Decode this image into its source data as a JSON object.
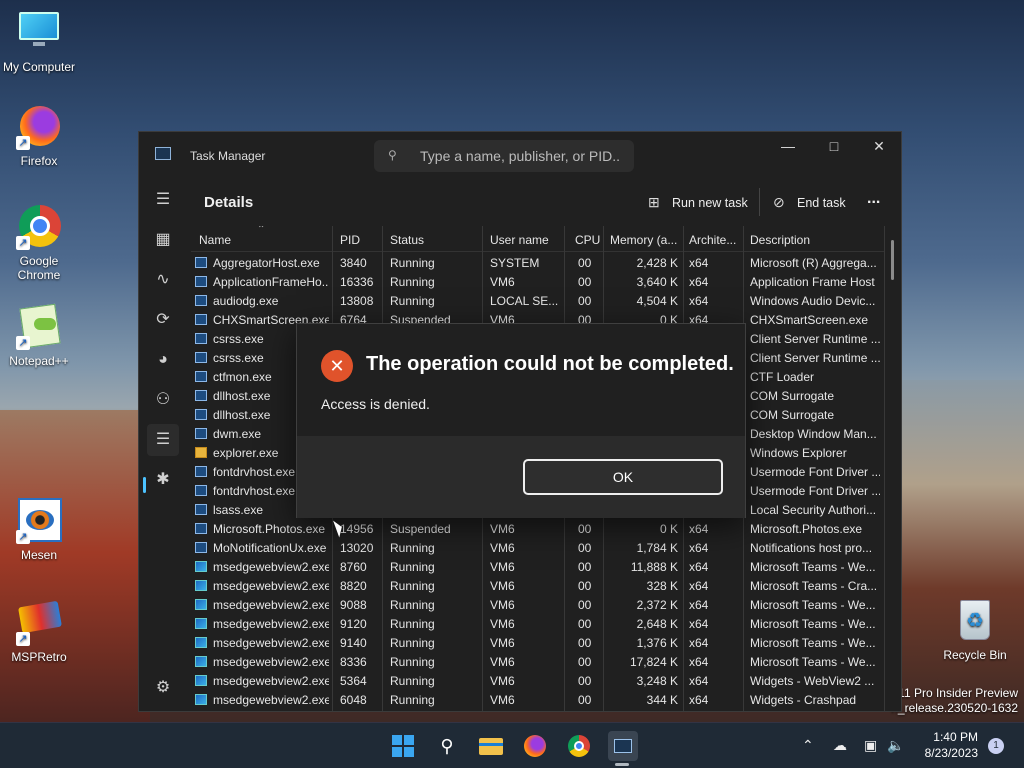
{
  "desktop": {
    "icons": [
      {
        "label": "My Computer",
        "icon": "monitor-icon"
      },
      {
        "label": "Firefox",
        "icon": "firefox-icon"
      },
      {
        "label": "Google Chrome",
        "icon": "chrome-icon"
      },
      {
        "label": "Notepad++",
        "icon": "notepadpp-icon"
      },
      {
        "label": "Mesen",
        "icon": "mesen-icon"
      },
      {
        "label": "MSPRetro",
        "icon": "mspretro-icon"
      },
      {
        "label": "Recycle Bin",
        "icon": "recycle-bin-icon"
      }
    ],
    "watermark": [
      "11 Pro Insider Preview",
      "n_release.230520-1632"
    ]
  },
  "window": {
    "title": "Task Manager",
    "search_placeholder": "Type a name, publisher, or PID...",
    "page_title": "Details",
    "toolbar": {
      "run_new_task": "Run new task",
      "end_task": "End task",
      "more": "..."
    }
  },
  "table": {
    "columns": [
      "Name",
      "PID",
      "Status",
      "User name",
      "CPU",
      "Memory (a...",
      "Archite...",
      "Description"
    ],
    "rows": [
      {
        "name": "AggregatorHost.exe",
        "pid": "3840",
        "status": "Running",
        "user": "SYSTEM",
        "cpu": "00",
        "mem": "2,428 K",
        "arch": "x64",
        "desc": "Microsoft (R) Aggrega...",
        "icon": "app"
      },
      {
        "name": "ApplicationFrameHo...",
        "pid": "16336",
        "status": "Running",
        "user": "VM6",
        "cpu": "00",
        "mem": "3,640 K",
        "arch": "x64",
        "desc": "Application Frame Host",
        "icon": "app"
      },
      {
        "name": "audiodg.exe",
        "pid": "13808",
        "status": "Running",
        "user": "LOCAL SE...",
        "cpu": "00",
        "mem": "4,504 K",
        "arch": "x64",
        "desc": "Windows Audio Devic...",
        "icon": "app"
      },
      {
        "name": "CHXSmartScreen.exe",
        "pid": "6764",
        "status": "Suspended",
        "user": "VM6",
        "cpu": "00",
        "mem": "0 K",
        "arch": "x64",
        "desc": "CHXSmartScreen.exe",
        "icon": "app"
      },
      {
        "name": "csrss.exe",
        "pid": "",
        "status": "",
        "user": "",
        "cpu": "",
        "mem": "",
        "arch": "",
        "desc": "Client Server Runtime ...",
        "icon": "app"
      },
      {
        "name": "csrss.exe",
        "pid": "",
        "status": "",
        "user": "",
        "cpu": "",
        "mem": "",
        "arch": "",
        "desc": "Client Server Runtime ...",
        "icon": "app"
      },
      {
        "name": "ctfmon.exe",
        "pid": "",
        "status": "",
        "user": "",
        "cpu": "",
        "mem": "",
        "arch": "",
        "desc": "CTF Loader",
        "icon": "app"
      },
      {
        "name": "dllhost.exe",
        "pid": "",
        "status": "",
        "user": "",
        "cpu": "",
        "mem": "",
        "arch": "",
        "desc": "COM Surrogate",
        "icon": "app"
      },
      {
        "name": "dllhost.exe",
        "pid": "",
        "status": "",
        "user": "",
        "cpu": "",
        "mem": "",
        "arch": "",
        "desc": "COM Surrogate",
        "icon": "app"
      },
      {
        "name": "dwm.exe",
        "pid": "",
        "status": "",
        "user": "",
        "cpu": "",
        "mem": "",
        "arch": "",
        "desc": "Desktop Window Man...",
        "icon": "app"
      },
      {
        "name": "explorer.exe",
        "pid": "",
        "status": "",
        "user": "",
        "cpu": "",
        "mem": "",
        "arch": "",
        "desc": "Windows Explorer",
        "icon": "folder"
      },
      {
        "name": "fontdrvhost.exe",
        "pid": "",
        "status": "",
        "user": "",
        "cpu": "",
        "mem": "",
        "arch": "",
        "desc": "Usermode Font Driver ...",
        "icon": "app"
      },
      {
        "name": "fontdrvhost.exe",
        "pid": "",
        "status": "",
        "user": "",
        "cpu": "",
        "mem": "",
        "arch": "",
        "desc": "Usermode Font Driver ...",
        "icon": "app"
      },
      {
        "name": "lsass.exe",
        "pid": "",
        "status": "",
        "user": "",
        "cpu": "",
        "mem": "",
        "arch": "",
        "desc": "Local Security Authori...",
        "icon": "app"
      },
      {
        "name": "Microsoft.Photos.exe",
        "pid": "14956",
        "status": "Suspended",
        "user": "VM6",
        "cpu": "00",
        "mem": "0 K",
        "arch": "x64",
        "desc": "Microsoft.Photos.exe",
        "icon": "app"
      },
      {
        "name": "MoNotificationUx.exe",
        "pid": "13020",
        "status": "Running",
        "user": "VM6",
        "cpu": "00",
        "mem": "1,784 K",
        "arch": "x64",
        "desc": "Notifications host pro...",
        "icon": "app"
      },
      {
        "name": "msedgewebview2.exe",
        "pid": "8760",
        "status": "Running",
        "user": "VM6",
        "cpu": "00",
        "mem": "11,888 K",
        "arch": "x64",
        "desc": "Microsoft Teams - We...",
        "icon": "edge"
      },
      {
        "name": "msedgewebview2.exe",
        "pid": "8820",
        "status": "Running",
        "user": "VM6",
        "cpu": "00",
        "mem": "328 K",
        "arch": "x64",
        "desc": "Microsoft Teams - Cra...",
        "icon": "edge"
      },
      {
        "name": "msedgewebview2.exe",
        "pid": "9088",
        "status": "Running",
        "user": "VM6",
        "cpu": "00",
        "mem": "2,372 K",
        "arch": "x64",
        "desc": "Microsoft Teams - We...",
        "icon": "edge"
      },
      {
        "name": "msedgewebview2.exe",
        "pid": "9120",
        "status": "Running",
        "user": "VM6",
        "cpu": "00",
        "mem": "2,648 K",
        "arch": "x64",
        "desc": "Microsoft Teams - We...",
        "icon": "edge"
      },
      {
        "name": "msedgewebview2.exe",
        "pid": "9140",
        "status": "Running",
        "user": "VM6",
        "cpu": "00",
        "mem": "1,376 K",
        "arch": "x64",
        "desc": "Microsoft Teams - We...",
        "icon": "edge"
      },
      {
        "name": "msedgewebview2.exe",
        "pid": "8336",
        "status": "Running",
        "user": "VM6",
        "cpu": "00",
        "mem": "17,824 K",
        "arch": "x64",
        "desc": "Microsoft Teams - We...",
        "icon": "edge"
      },
      {
        "name": "msedgewebview2.exe",
        "pid": "5364",
        "status": "Running",
        "user": "VM6",
        "cpu": "00",
        "mem": "3,248 K",
        "arch": "x64",
        "desc": "Widgets - WebView2 ...",
        "icon": "edge"
      },
      {
        "name": "msedgewebview2.exe",
        "pid": "6048",
        "status": "Running",
        "user": "VM6",
        "cpu": "00",
        "mem": "344 K",
        "arch": "x64",
        "desc": "Widgets - Crashpad",
        "icon": "edge"
      }
    ]
  },
  "dialog": {
    "title": "The operation could not be completed.",
    "message": "Access is denied.",
    "ok": "OK"
  },
  "taskbar": {
    "time": "1:40 PM",
    "date": "8/23/2023",
    "notifications": "1"
  }
}
